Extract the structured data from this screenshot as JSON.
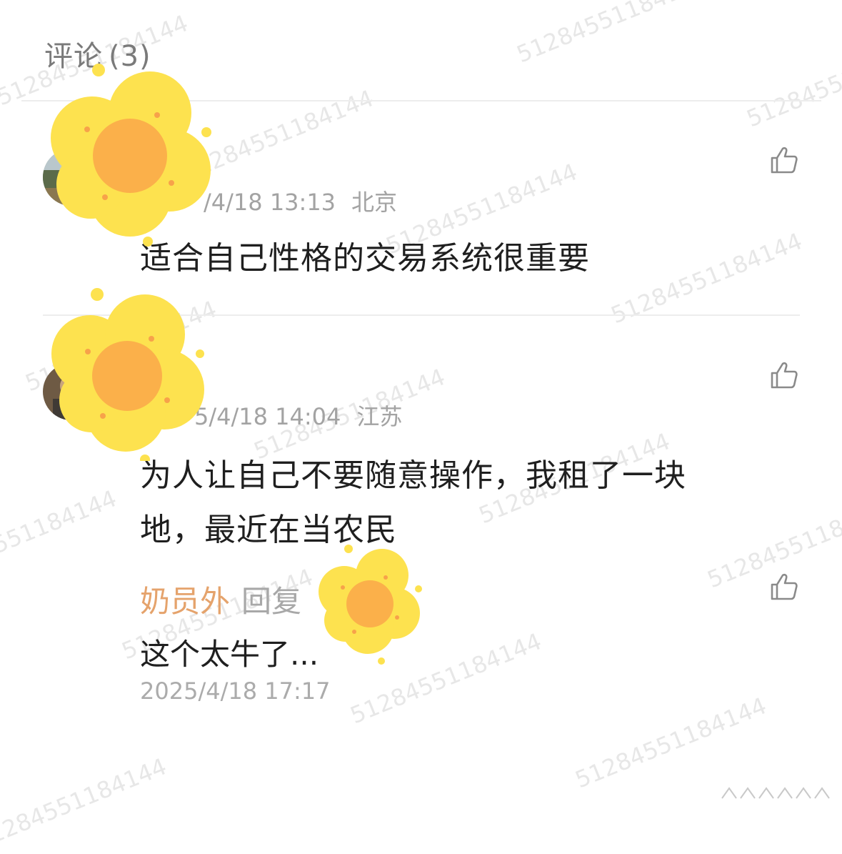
{
  "comments_header": {
    "label": "评论",
    "count": "(3)"
  },
  "comments": [
    {
      "time": "/4/18 13:13",
      "location": "北京",
      "content": "适合自己性格的交易系统很重要"
    },
    {
      "time": "5/4/18 14:04",
      "location": "江苏",
      "content_lines": [
        "为人让自己不要随意操作，我租了一块",
        "地，最近在当农民"
      ],
      "reply": {
        "author": "奶员外",
        "verb": "回复",
        "text": "这个太牛了...",
        "time": "2025/4/18 17:17"
      }
    }
  ],
  "watermark": "51284551184144",
  "colors": {
    "reply_author": "#e5a36c",
    "meta_gray": "#a3a3a3",
    "flower_petal": "#fde24f",
    "flower_center": "#fbb04a"
  },
  "icons": {
    "like": "thumbs-up-icon",
    "privacy_sticker": "flower-sticker"
  }
}
